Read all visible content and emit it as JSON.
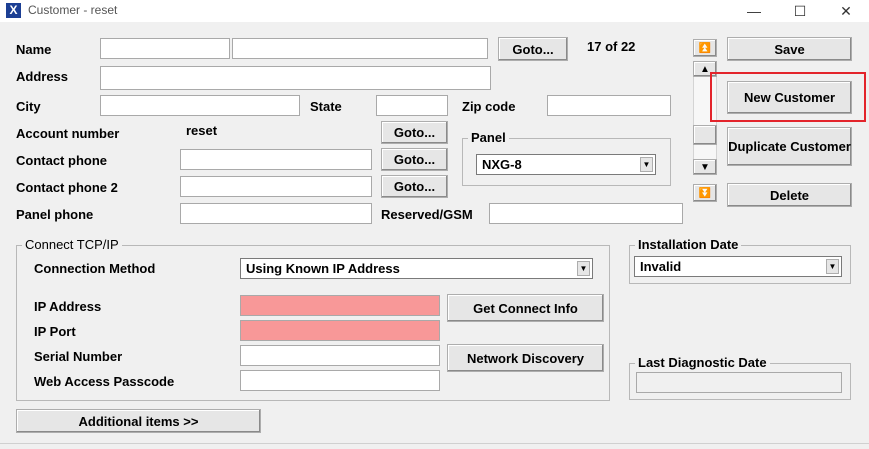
{
  "window": {
    "title": "Customer - reset",
    "minimize": "—",
    "maximize": "☐",
    "close": "✕"
  },
  "labels": {
    "name": "Name",
    "address": "Address",
    "city": "City",
    "state": "State",
    "zip": "Zip code",
    "account": "Account number",
    "contact_phone": "Contact phone",
    "contact_phone2": "Contact phone 2",
    "panel_phone": "Panel phone",
    "reserved_gsm": "Reserved/GSM"
  },
  "values": {
    "account_number": "reset"
  },
  "record_position": "17 of 22",
  "buttons": {
    "goto": "Goto...",
    "save": "Save",
    "new_customer": "New Customer",
    "duplicate_customer": "Duplicate Customer",
    "delete": "Delete",
    "get_connect_info": "Get Connect Info",
    "network_discovery": "Network Discovery",
    "additional_items": "Additional items  >>"
  },
  "nav": {
    "first": "⏫",
    "up": "▲",
    "down": "▼",
    "last": "⏬"
  },
  "panel": {
    "legend": "Panel",
    "selected": "NXG-8"
  },
  "connect": {
    "legend": "Connect TCP/IP",
    "method_label": "Connection Method",
    "method_value": "Using Known IP Address",
    "ip_address": "IP Address",
    "ip_port": "IP Port",
    "serial": "Serial Number",
    "web_passcode": "Web Access Passcode"
  },
  "installation": {
    "legend": "Installation Date",
    "value": "Invalid"
  },
  "diagnostic": {
    "legend": "Last Diagnostic Date"
  },
  "colors": {
    "invalid_field": "#f89898",
    "highlight": "#e3242b"
  }
}
